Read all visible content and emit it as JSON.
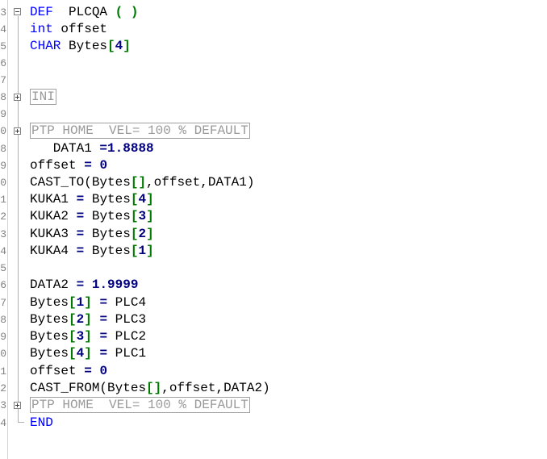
{
  "editor": {
    "gutter_numbers": [
      "3",
      "4",
      "5",
      "6",
      "7",
      "8",
      "9",
      "0",
      "8",
      "9",
      "0",
      "1",
      "2",
      "3",
      "4",
      "5",
      "6",
      "7",
      "8",
      "9",
      "0",
      "1",
      "2",
      "3",
      "4"
    ],
    "lines": [
      {
        "kw": "DEF",
        "name": "PLCQA",
        "lp": "(",
        "rp": ")"
      },
      {
        "kw": "int",
        "rest": "offset"
      },
      {
        "kw": "CHAR",
        "rest": "Bytes",
        "lb": "[",
        "n": "4",
        "rb": "]"
      },
      {},
      {},
      {
        "fold": "INI"
      },
      {},
      {
        "fold": "PTP HOME  VEL= 100 % DEFAULT"
      },
      {
        "indent": "   ",
        "var": "DATA1",
        "op": "=",
        "val": "1.8888"
      },
      {
        "var": "offset",
        "op": "=",
        "val": "0"
      },
      {
        "call": "CAST_TO",
        "args": [
          "Bytes",
          "[]",
          ",offset,DATA1)"
        ]
      },
      {
        "var": "KUKA1",
        "op": "=",
        "arr": "Bytes",
        "idx": "4"
      },
      {
        "var": "KUKA2",
        "op": "=",
        "arr": "Bytes",
        "idx": "3"
      },
      {
        "var": "KUKA3",
        "op": "=",
        "arr": "Bytes",
        "idx": "2"
      },
      {
        "var": "KUKA4",
        "op": "=",
        "arr": "Bytes",
        "idx": "1"
      },
      {},
      {
        "var": "DATA2",
        "op": "=",
        "val": "1.9999"
      },
      {
        "arr": "Bytes",
        "idx": "1",
        "op": "=",
        "rhs": "PLC4"
      },
      {
        "arr": "Bytes",
        "idx": "2",
        "op": "=",
        "rhs": "PLC3"
      },
      {
        "arr": "Bytes",
        "idx": "3",
        "op": "=",
        "rhs": "PLC2"
      },
      {
        "arr": "Bytes",
        "idx": "4",
        "op": "=",
        "rhs": "PLC1"
      },
      {
        "var": "offset",
        "op": "=",
        "val": "0"
      },
      {
        "call": "CAST_FROM",
        "args": [
          "Bytes",
          "[]",
          ",offset,DATA2)"
        ]
      },
      {
        "fold": "PTP HOME  VEL= 100 % DEFAULT"
      },
      {
        "kw": "END"
      }
    ]
  },
  "text": {
    "l1_kw": "DEF",
    "l1_name": "PLCQA",
    "l1_lp": "(",
    "l1_rp": ")",
    "l2_kw": "int",
    "l2_rest": "offset",
    "l3_kw": "CHAR",
    "l3_rest": "Bytes",
    "l3_lb": "[",
    "l3_n": "4",
    "l3_rb": "]",
    "ini": "INI",
    "ptp": "PTP HOME  VEL= 100 % DEFAULT",
    "data1": "   DATA1",
    "eq": "=",
    "v1": "1.8888",
    "offset": "offset",
    "zero": "0",
    "cast_to": "CAST_TO",
    "bytes": "Bytes",
    "brk_empty": "[]",
    "cast_to_rest": ",offset,DATA1)",
    "kuka1": "KUKA1",
    "kuka2": "KUKA2",
    "kuka3": "KUKA3",
    "kuka4": "KUKA4",
    "lb": "[",
    "rb": "]",
    "n4": "4",
    "n3": "3",
    "n2": "2",
    "n1": "1",
    "data2": "DATA2",
    "v2": "1.9999",
    "plc4": "PLC4",
    "plc3": "PLC3",
    "plc2": "PLC2",
    "plc1": "PLC1",
    "cast_from": "CAST_FROM",
    "cast_from_rest": ",offset,DATA2)",
    "end": "END"
  }
}
